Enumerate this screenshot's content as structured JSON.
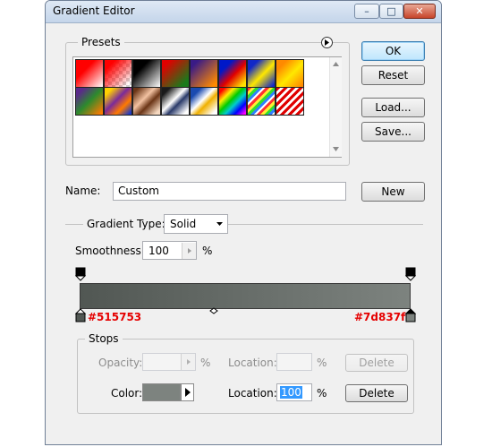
{
  "window": {
    "title": "Gradient Editor",
    "buttons": {
      "minimize": "–",
      "maximize": "□",
      "close": "✕"
    }
  },
  "presets": {
    "legend": "Presets",
    "menu_icon": "circle-arrow-right-icon",
    "swatches": [
      "red-transparent",
      "red-checker",
      "black-white",
      "red-green",
      "violet-orange",
      "blue-red-yellow",
      "blue-yellow-blue",
      "orange-yellow-orange",
      "violet-green-orange",
      "yellow-violet-orange-blue",
      "copper",
      "chrome",
      "spectrum",
      "transparent-rainbow",
      "transparent-stripes"
    ]
  },
  "actions": {
    "ok": "OK",
    "reset": "Reset",
    "load": "Load...",
    "save": "Save...",
    "new": "New"
  },
  "name": {
    "label": "Name:",
    "value": "Custom"
  },
  "gradient": {
    "type_label": "Gradient Type:",
    "type_value": "Solid",
    "smoothness_label": "Smoothness:",
    "smoothness_value": "100",
    "percent": "%",
    "left_color": "#515753",
    "right_color": "#7d837f",
    "left_label": "#515753",
    "right_label": "#7d837f"
  },
  "stops": {
    "legend": "Stops",
    "opacity_label": "Opacity:",
    "opacity_value": "",
    "opacity_unit": "%",
    "location_label_top": "Location:",
    "location_value_top": "",
    "location_unit_top": "%",
    "delete_top": "Delete",
    "color_label": "Color:",
    "color_value": "#7d837f",
    "location_label": "Location:",
    "location_value": "100",
    "location_unit": "%",
    "delete_bottom": "Delete"
  }
}
